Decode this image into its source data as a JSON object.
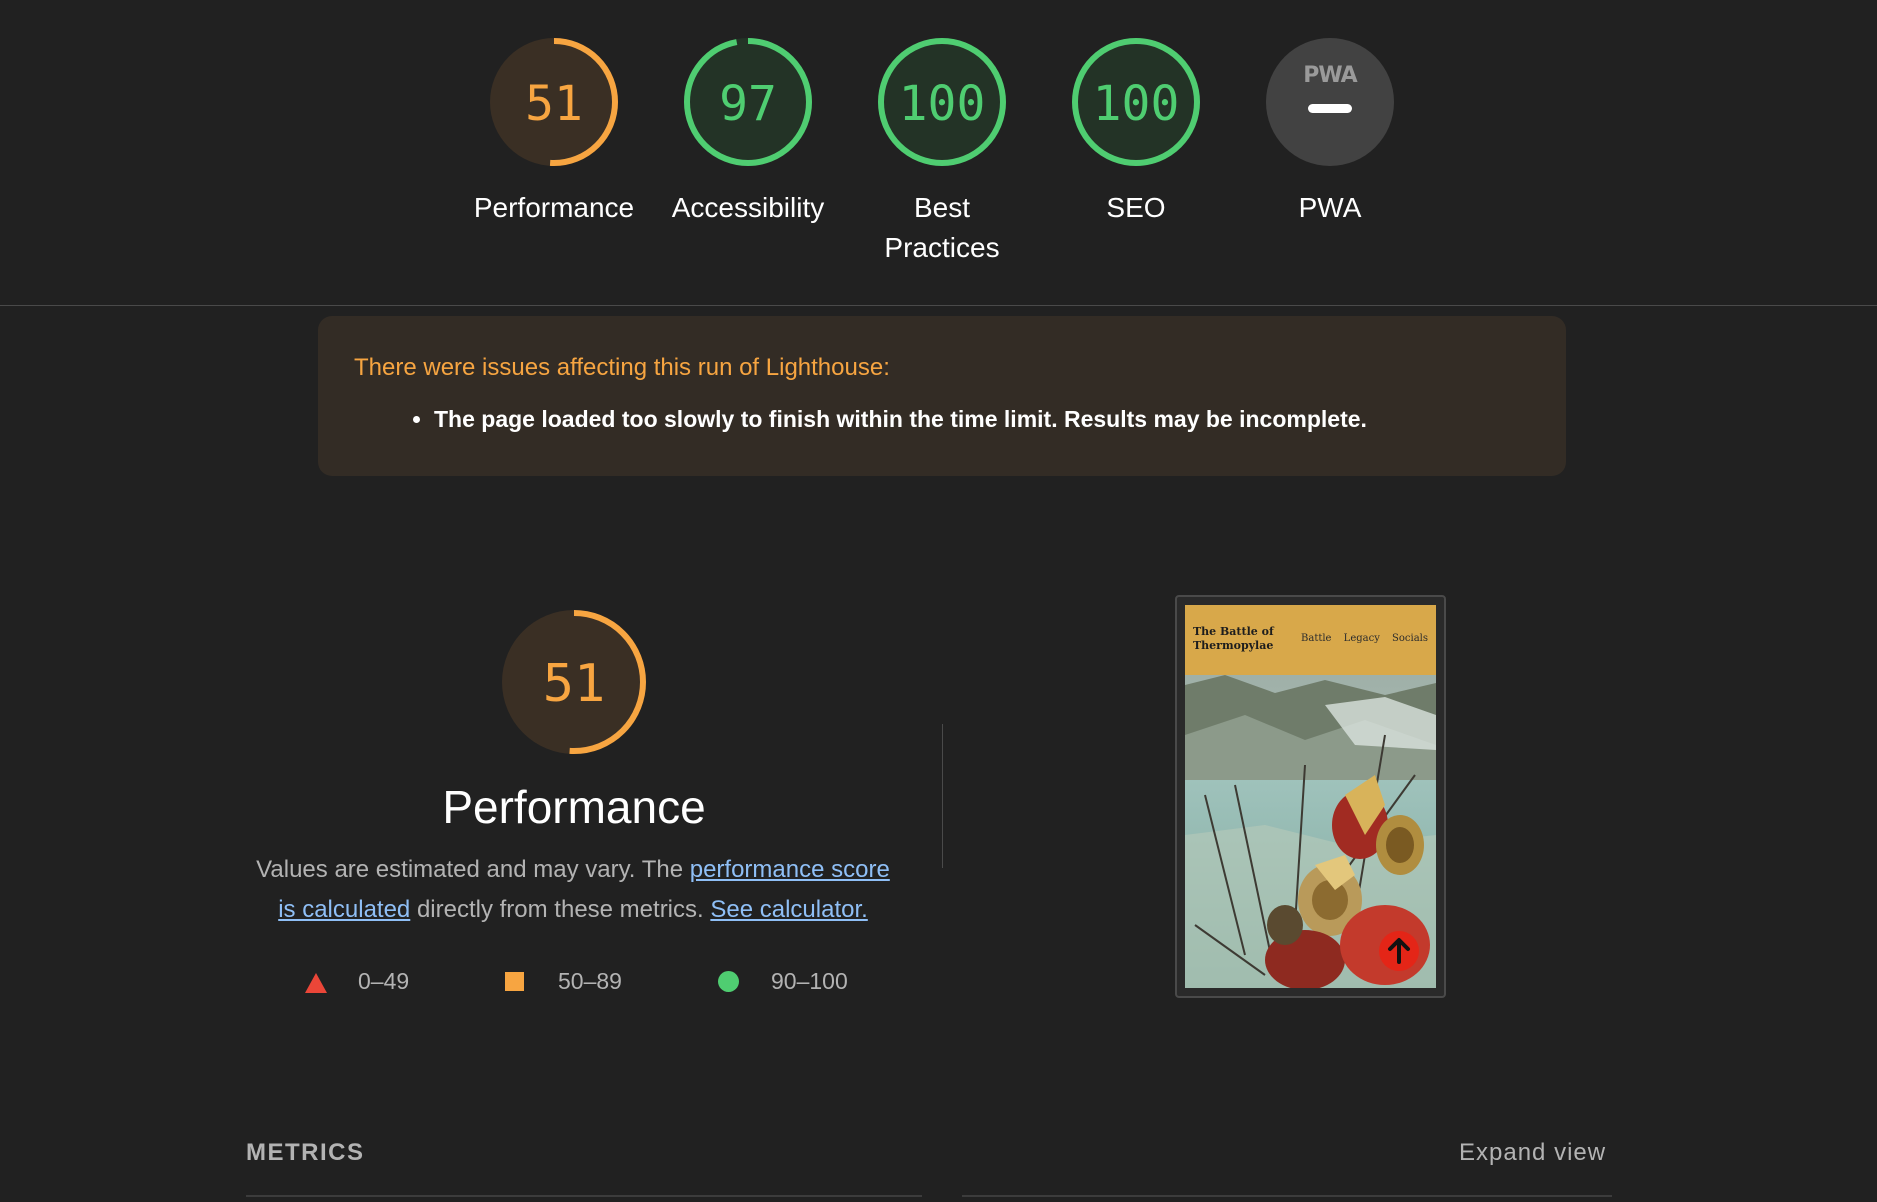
{
  "gauges": [
    {
      "label": "Performance",
      "score": "51",
      "value": 51,
      "color": "#f7a541"
    },
    {
      "label": "Accessibility",
      "score": "97",
      "value": 97,
      "color": "#4fcd71"
    },
    {
      "label": "Best Practices",
      "score": "100",
      "value": 100,
      "color": "#4fcd71"
    },
    {
      "label": "SEO",
      "score": "100",
      "value": 100,
      "color": "#4fcd71"
    },
    {
      "label": "PWA",
      "score": "PWA",
      "value": null,
      "color": "#9a9a9a"
    }
  ],
  "warning": {
    "title": "There were issues affecting this run of Lighthouse:",
    "items": [
      "The page loaded too slowly to finish within the time limit. Results may be incomplete."
    ]
  },
  "performance": {
    "score": "51",
    "value": 51,
    "color": "#f7a541",
    "title": "Performance",
    "desc_prefix": "Values are estimated and may vary. The ",
    "link_score": "performance score is calculated",
    "desc_middle": " directly from these metrics. ",
    "link_calculator": "See calculator.",
    "legend": [
      {
        "range": "0–49",
        "color": "#eb4638"
      },
      {
        "range": "50–89",
        "color": "#f7a541"
      },
      {
        "range": "90–100",
        "color": "#4fcd71"
      }
    ]
  },
  "thumbnail": {
    "site_title": "The Battle of Thermopylae",
    "nav": [
      "Battle",
      "Legacy",
      "Socials"
    ]
  },
  "metrics": {
    "title": "METRICS",
    "expand_label": "Expand view"
  }
}
